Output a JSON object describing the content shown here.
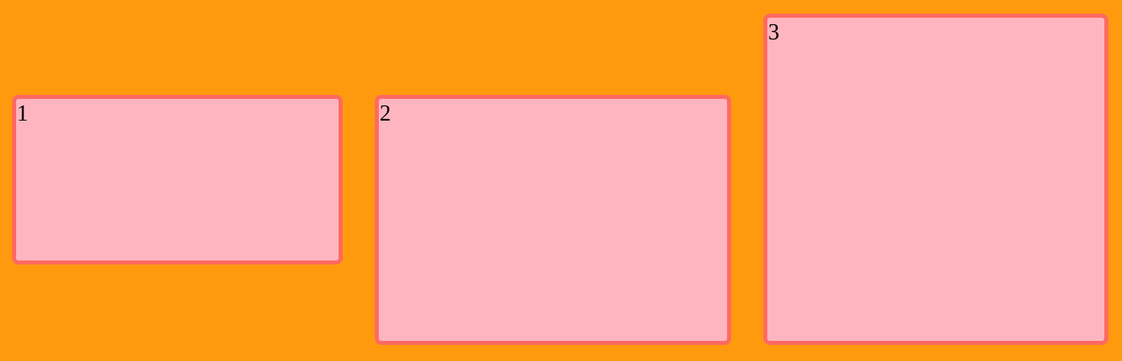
{
  "boxes": [
    {
      "label": "1"
    },
    {
      "label": "2"
    },
    {
      "label": "3"
    }
  ],
  "colors": {
    "background": "#ff9a0f",
    "box_fill": "#ffb5c0",
    "box_border": "#ff6961",
    "text": "#000000"
  }
}
